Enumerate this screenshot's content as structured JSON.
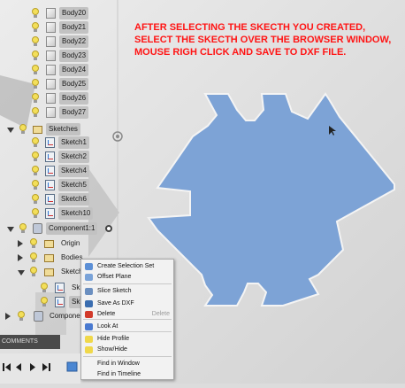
{
  "instruction": "AFTER SELECTING THE SKECTH YOU CREATED, SELECT THE SKECTH OVER THE BROWSER WINDOW, MOUSE RIGH CLICK AND SAVE TO DXF FILE.",
  "bodies": [
    "Body20",
    "Body21",
    "Body22",
    "Body23",
    "Body24",
    "Body25",
    "Body26",
    "Body27"
  ],
  "sketches_folder": "Sketches",
  "sketches": [
    "Sketch1",
    "Sketch2",
    "Sketch4",
    "Sketch5",
    "Sketch6",
    "Sketch10"
  ],
  "component": {
    "name": "Component1:1",
    "children": [
      "Origin",
      "Bodies",
      "Sketch",
      "Sk"
    ],
    "next": "Componer"
  },
  "context_menu": {
    "items": [
      {
        "label": "Create Selection Set",
        "icon": "selection-set-icon"
      },
      {
        "label": "Offset Plane",
        "icon": "offset-plane-icon"
      },
      {
        "label": "Slice Sketch",
        "icon": "slice-icon"
      },
      {
        "label": "Save As DXF",
        "icon": "dxf-icon"
      },
      {
        "label": "Delete",
        "shortcut": "Delete",
        "icon": "delete-icon"
      },
      {
        "label": "Look At",
        "icon": "look-at-icon"
      },
      {
        "label": "Hide Profile",
        "icon": "bulb-icon"
      },
      {
        "label": "Show/Hide",
        "icon": "bulb-icon"
      },
      {
        "label": "Find in Window",
        "icon": ""
      },
      {
        "label": "Find in Timeline",
        "icon": ""
      }
    ],
    "highlighted": "Save As DXF"
  },
  "comments_label": "COMMENTS",
  "colors": {
    "instruction": "#ff1414",
    "shape_fill": "#7da3d6",
    "shape_stroke": "#f4f4f4",
    "highlight_border": "#e0141e",
    "background": "#dcdcdc"
  }
}
